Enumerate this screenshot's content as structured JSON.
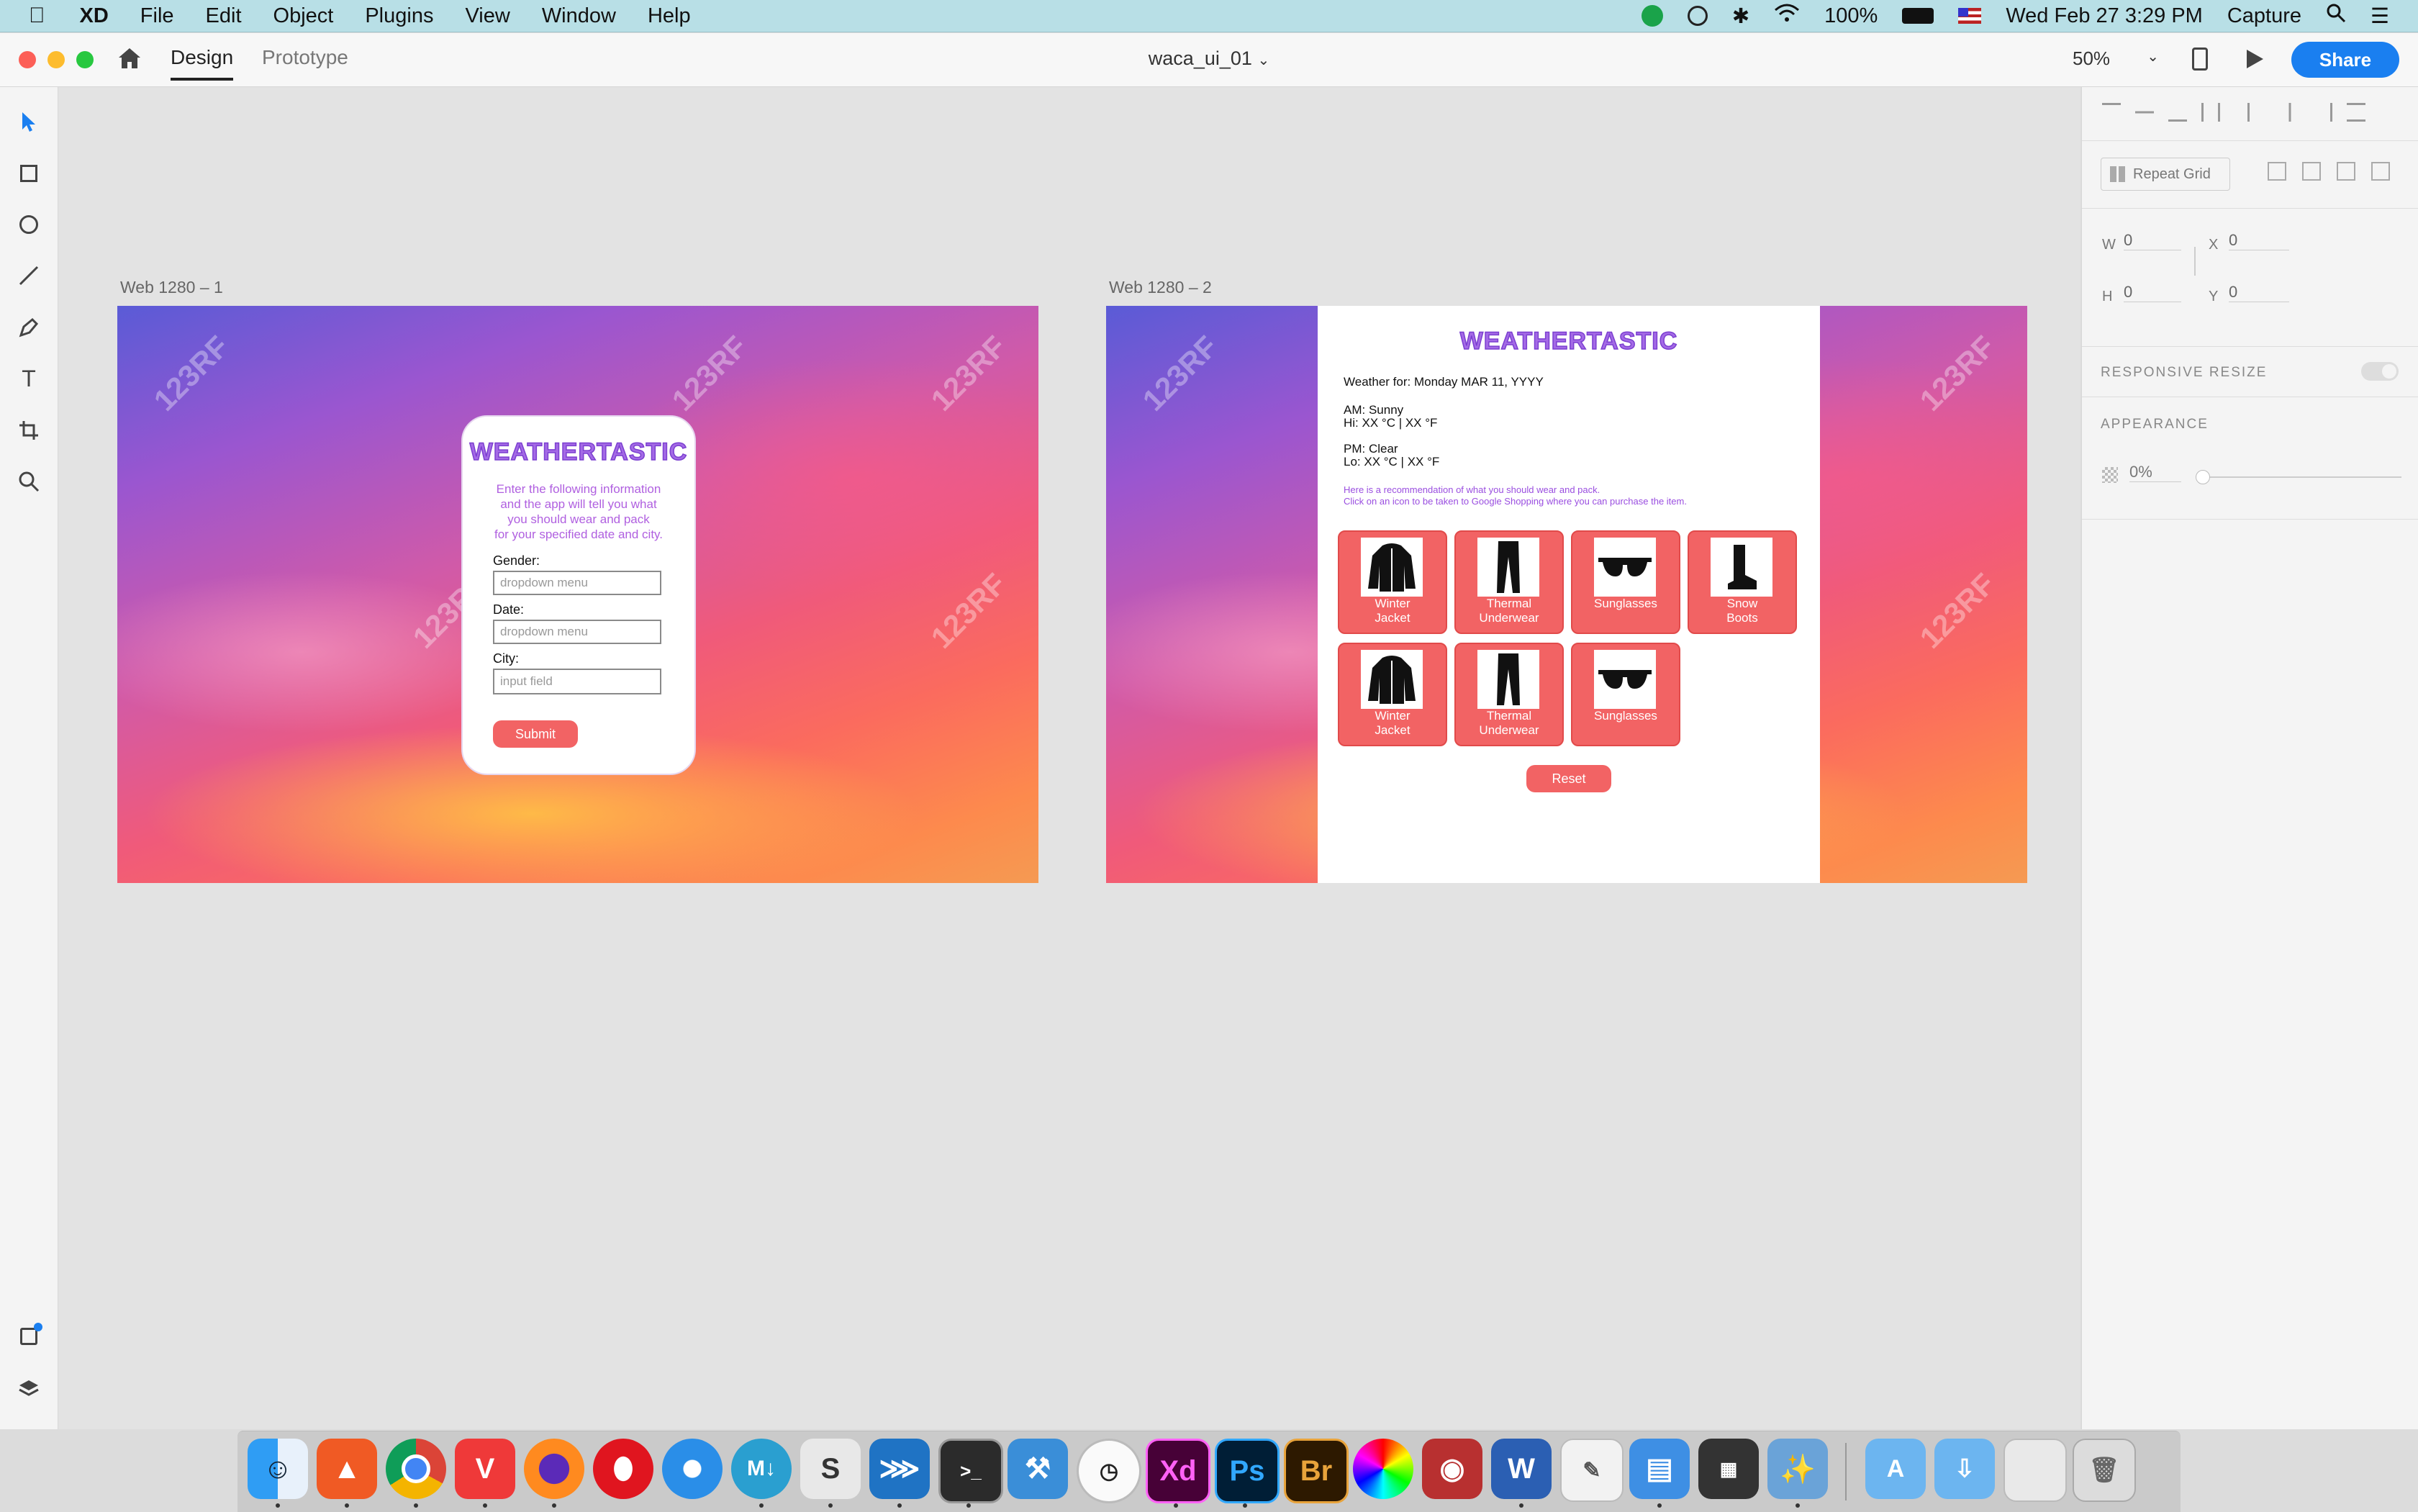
{
  "menubar": {
    "app_name": "XD",
    "menus": [
      "File",
      "Edit",
      "Object",
      "Plugins",
      "View",
      "Window",
      "Help"
    ],
    "battery": "100%",
    "datetime": "Wed Feb 27  3:29 PM",
    "capture": "Capture"
  },
  "titlebar": {
    "tabs": [
      "Design",
      "Prototype"
    ],
    "doc_title": "waca_ui_01",
    "zoom": "50%",
    "share_label": "Share"
  },
  "toolbar": {
    "tools": [
      "select-tool",
      "rectangle-tool",
      "ellipse-tool",
      "line-tool",
      "pen-tool",
      "text-tool",
      "artboard-tool",
      "zoom-tool"
    ]
  },
  "right_panel": {
    "repeat_grid": "Repeat Grid",
    "w_label": "W",
    "w_value": "0",
    "h_label": "H",
    "h_value": "0",
    "x_label": "X",
    "x_value": "0",
    "y_label": "Y",
    "y_value": "0",
    "responsive_resize": "RESPONSIVE RESIZE",
    "appearance": "APPEARANCE",
    "opacity": "0%"
  },
  "artboard1": {
    "label": "Web 1280 – 1",
    "watermark": "123RF",
    "brand": "WEATHERTASTIC",
    "intro": [
      "Enter the following information",
      "and the app will tell you what",
      "you should wear and pack",
      "for your specified date and city."
    ],
    "gender_label": "Gender:",
    "gender_placeholder": "dropdown menu",
    "date_label": "Date:",
    "date_placeholder": "dropdown menu",
    "city_label": "City:",
    "city_placeholder": "input field",
    "submit": "Submit"
  },
  "artboard2": {
    "label": "Web 1280 – 2",
    "watermark": "123RF",
    "brand": "WEATHERTASTIC",
    "weather_for": "Weather for: Monday MAR 11, YYYY",
    "am_line1": "AM: Sunny",
    "am_line2": "Hi: XX °C | XX °F",
    "pm_line1": "PM: Clear",
    "pm_line2": "Lo: XX °C | XX °F",
    "rec_line1": "Here is a recommendation of what you should wear and pack.",
    "rec_line2": "Click on an icon to be taken to Google Shopping where you can purchase the item.",
    "tiles_row1": [
      {
        "icon": "jacket-icon",
        "line1": "Winter",
        "line2": "Jacket"
      },
      {
        "icon": "underwear-icon",
        "line1": "Thermal",
        "line2": "Underwear"
      },
      {
        "icon": "sunglasses-icon",
        "line1": "Sunglasses",
        "line2": ""
      },
      {
        "icon": "boot-icon",
        "line1": "Snow",
        "line2": "Boots"
      }
    ],
    "tiles_row2": [
      {
        "icon": "jacket-icon",
        "line1": "Winter",
        "line2": "Jacket"
      },
      {
        "icon": "underwear-icon",
        "line1": "Thermal",
        "line2": "Underwear"
      },
      {
        "icon": "sunglasses-icon",
        "line1": "Sunglasses",
        "line2": ""
      }
    ],
    "reset": "Reset"
  },
  "dock": {
    "apps": [
      "Finder",
      "Brave",
      "Chrome",
      "Vivaldi",
      "Firefox",
      "Opera",
      "Safari",
      "MacDown",
      "Sublime Text",
      "VS Code",
      "Terminal",
      "Xcode",
      "Clock",
      "Adobe XD",
      "Photoshop",
      "Bridge",
      "Color Picker",
      "Photo Booth",
      "Word",
      "TextEdit",
      "Keynote",
      "Calendar",
      "Preview",
      "Applications",
      "Downloads",
      "Screenshots",
      "Trash"
    ],
    "labels": {
      "xd": "Xd",
      "ps": "Ps",
      "br": "Br",
      "w": "W"
    }
  },
  "colors": {
    "accent_blue": "#1a7ff0",
    "brand_purple": "#a46ae6",
    "tile_red": "#f26364"
  }
}
